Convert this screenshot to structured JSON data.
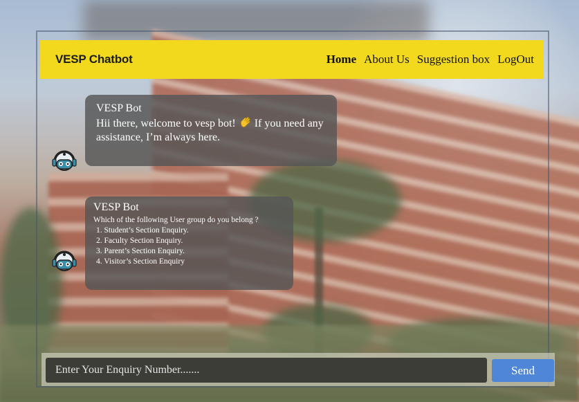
{
  "navbar": {
    "brand": "VESP Chatbot",
    "links": [
      "Home",
      "About Us",
      "Suggestion box",
      "LogOut"
    ],
    "active": "Home",
    "bg_color": "#f2d91d"
  },
  "messages": [
    {
      "sender": "VESP Bot",
      "text_before_emoji": "Hii there, welcome to vesp bot!",
      "emoji": "waving-hand-icon",
      "text_after_emoji": "If you need any assistance, I’m always here."
    },
    {
      "sender": "VESP Bot",
      "prompt": "Which of the following User group do you belong ?",
      "options": [
        "1.  Student’s Section Enquiry.",
        "2.  Faculty Section Enquiry.",
        "3.  Parent’s Section Enquiry.",
        "4.  Visitor’s Section Enquiry"
      ]
    }
  ],
  "input": {
    "placeholder": "Enter Your Enquiry Number.......",
    "value": ""
  },
  "send_label": "Send",
  "colors": {
    "bubble": "#555555",
    "send_button": "#4f86d8",
    "input_bg": "#3b3d36"
  }
}
